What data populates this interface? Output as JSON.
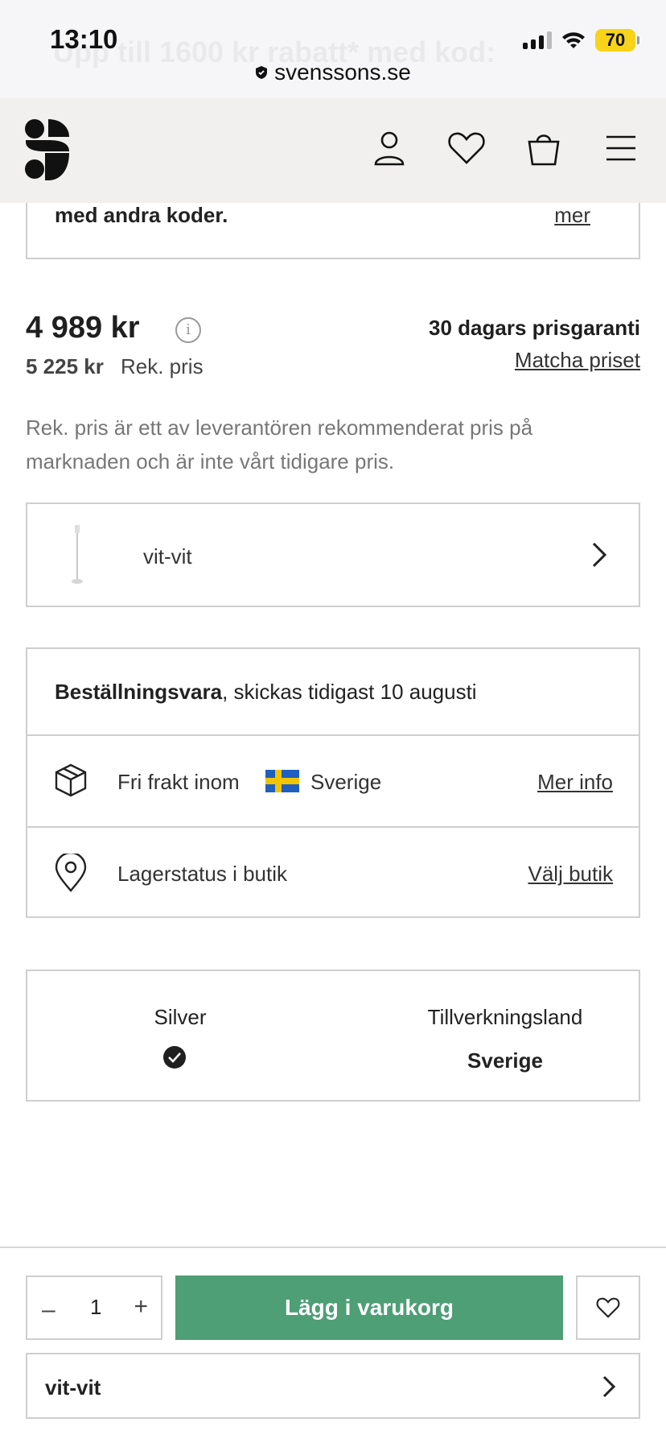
{
  "status_bar": {
    "time": "13:10",
    "battery": "70",
    "url": "svenssons.se",
    "ghost_text": "Upp till 1600 kr rabatt* med kod:"
  },
  "header": {
    "icons": [
      "logo-icon",
      "account-icon",
      "heart-icon",
      "bag-icon",
      "menu-icon"
    ]
  },
  "promo": {
    "text": "med andra koder.",
    "link": "mer"
  },
  "price": {
    "current": "4 989 kr",
    "recommended": "5 225 kr",
    "recommended_label": "Rek. pris",
    "guarantee": "30 dagars prisgaranti",
    "match_link": "Matcha priset",
    "disclaimer": "Rek. pris är ett av leverantören rekommenderat pris på marknaden och är inte vårt tidigare pris."
  },
  "variant": {
    "label": "vit-vit"
  },
  "info": {
    "order_bold": "Beställningsvara",
    "order_rest": ", skickas tidigast 10 augusti",
    "shipping_label": "Fri frakt inom",
    "shipping_country": "Sverige",
    "shipping_link": "Mer info",
    "stock_label": "Lagerstatus i butik",
    "stock_link": "Välj butik"
  },
  "attributes": {
    "color_title": "Silver",
    "country_title": "Tillverkningsland",
    "country_value": "Sverige"
  },
  "bottom_bar": {
    "minus": "–",
    "quantity": "1",
    "plus": "+",
    "add_to_cart": "Lägg i varukorg",
    "variant_label": "vit-vit"
  },
  "colors": {
    "accent_green": "#4e9e76",
    "battery_yellow": "#f7d31a",
    "border": "#cfcfcf"
  }
}
